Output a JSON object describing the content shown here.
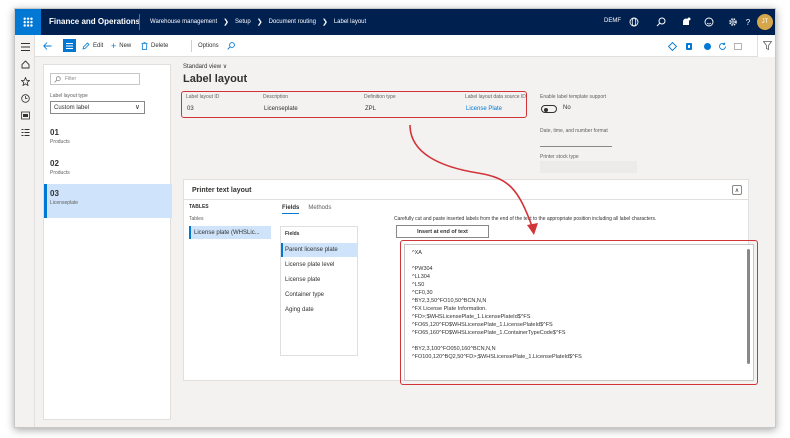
{
  "topbar": {
    "app_title": "Finance and Operations",
    "breadcrumbs": [
      "Warehouse management",
      "Setup",
      "Document routing",
      "Label layout"
    ],
    "company": "DEMF",
    "avatar_initials": "JT"
  },
  "actionbar": {
    "edit": "Edit",
    "new": "New",
    "delete": "Delete",
    "options": "Options"
  },
  "leftpane": {
    "filter_placeholder": "Filter",
    "layout_type_label": "Label layout type",
    "layout_type_value": "Custom label",
    "items": [
      {
        "id": "01",
        "desc": "Products"
      },
      {
        "id": "02",
        "desc": "Products"
      },
      {
        "id": "03",
        "desc": "Licenseplate"
      }
    ]
  },
  "main": {
    "view": "Standard view ∨",
    "title": "Label layout",
    "fields": {
      "layout_id_label": "Label layout ID",
      "layout_id_value": "03",
      "description_label": "Description",
      "description_value": "Licenseplate",
      "definition_label": "Definition type",
      "definition_value": "ZPL",
      "datasource_label": "Label layout data source ID",
      "datasource_value": "License Plate",
      "enable_label": "Enable label template support",
      "enable_value": "No",
      "date_format_label": "Date, time, and number format",
      "stock_type_label": "Printer stock type"
    }
  },
  "ptl": {
    "title": "Printer text layout",
    "tables_header": "TABLES",
    "tables_col": "Tables",
    "tables_row": "License plate (WHSLic...",
    "tabs": [
      "Fields",
      "Methods"
    ],
    "fields_header": "Fields",
    "fields": [
      "Parent license plate",
      "License plate level",
      "License plate",
      "Container type",
      "Aging date"
    ],
    "instructions": "Carefully cut and paste inserted labels from the end of the text to the appropriate position including all label characters.",
    "insert_button": "Insert at end of text",
    "code_lines": [
      "^XA",
      "",
      "^PW304",
      "^LL304",
      "^LS0",
      "^CF0,30",
      "^BY2,3,50^FO10,50^BCN,N,N",
      "^FX License Plate Information.",
      "^FD>;$WHSLicensePlate_1.LicensePlateId$^FS",
      "^FO65,120^FD$WHSLicensePlate_1.LicensePlateId$^FS",
      "^FO65,160^FD$WHSLicensePlate_1.ContainerTypeCode$^FS",
      "",
      "^BY2,3,100^FO050,160^BCN,N,N",
      "^FO100,120^BQ2,50^FD>;$WHSLicensePlate_1.LicensePlateId$^FS"
    ]
  },
  "colors": {
    "topbar": "#002050",
    "accent": "#0078d4",
    "highlight": "#d13438",
    "selected": "#cfe4fa"
  }
}
